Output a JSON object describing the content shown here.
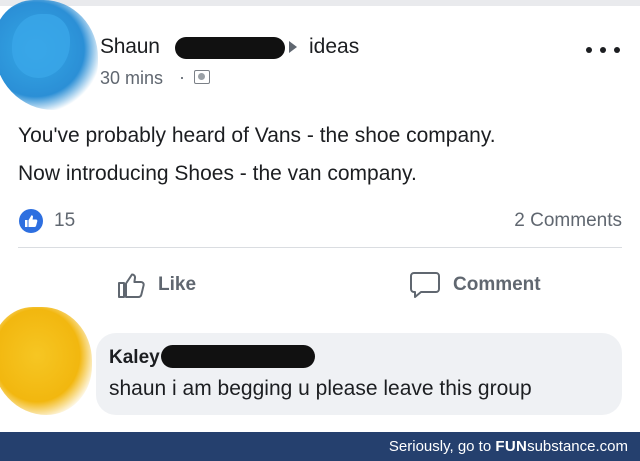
{
  "post": {
    "author": "Shaun",
    "group": "ideas",
    "time": "30 mins",
    "separator": "·",
    "lines": [
      "You've probably heard of Vans - the shoe company.",
      "Now introducing Shoes - the van company."
    ],
    "like_count": "15",
    "comment_count": "2 Comments",
    "actions": {
      "like": "Like",
      "comment": "Comment"
    }
  },
  "comment": {
    "author": "Kaley",
    "text": "shaun i am begging u please leave this group"
  },
  "footer": {
    "prefix": "Seriously, go to ",
    "brand_a": "FUN",
    "brand_b": "substance",
    "brand_c": ".com"
  },
  "colors": {
    "like_blue": "#2d6fe0",
    "footer_bg": "#25406e"
  }
}
